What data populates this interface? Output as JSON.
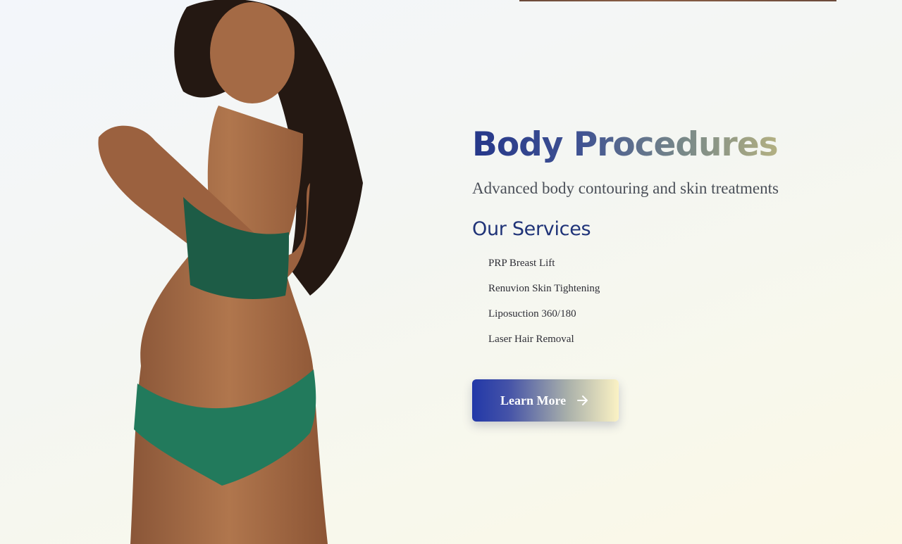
{
  "hero": {
    "title": "Body Procedures",
    "subtitle": "Advanced body contouring and skin treatments"
  },
  "services": {
    "heading": "Our Services",
    "items": [
      "PRP Breast Lift",
      "Renuvion Skin Tightening",
      "Liposuction 360/180",
      "Laser Hair Removal"
    ]
  },
  "cta": {
    "label": "Learn More",
    "icon": "arrow-right-icon"
  },
  "colors": {
    "title_gradient_start": "#25378a",
    "title_gradient_end": "#b3b082",
    "heading": "#1f3378",
    "button_gradient_start": "#2238a8",
    "button_gradient_end": "#fbf2c4"
  }
}
